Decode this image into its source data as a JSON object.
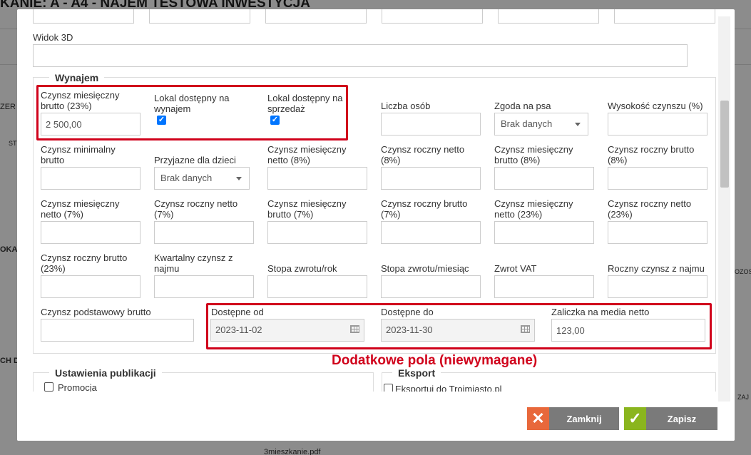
{
  "background": {
    "title": "KANIE: A - A4 - NAJEM TESTOWA INWESTYCJA",
    "fragments": [
      "ZER",
      "ST",
      "OKA",
      "CH D",
      "OZOS",
      "ZAJ",
      "3mieszkanie.pdf"
    ]
  },
  "modal": {
    "widok3d": {
      "label": "Widok 3D",
      "value": ""
    },
    "wynajem": {
      "legend": "Wynajem",
      "czynsz_miesieczny_brutto_23": {
        "label": "Czynsz miesięczny brutto (23%)",
        "value": "2 500,00"
      },
      "lokal_dostepny_na_wynajem": {
        "label": "Lokal dostępny na wynajem",
        "checked": true
      },
      "lokal_dostepny_na_sprzedaz": {
        "label": "Lokal dostępny na sprzedaż",
        "checked": true
      },
      "liczba_osob": {
        "label": "Liczba osób",
        "value": ""
      },
      "zgoda_na_psa": {
        "label": "Zgoda na psa",
        "value": "Brak danych"
      },
      "wysokosc_czynszu": {
        "label": "Wysokość czynszu (%)",
        "value": ""
      },
      "czynsz_minimalny_brutto": {
        "label": "Czynsz minimalny brutto",
        "value": ""
      },
      "przyjazne_dla_dzieci": {
        "label": "Przyjazne dla dzieci",
        "value": "Brak danych"
      },
      "czynsz_miesieczny_netto_8": {
        "label": "Czynsz miesięczny netto (8%)",
        "value": ""
      },
      "czynsz_roczny_netto_8": {
        "label": "Czynsz roczny netto (8%)",
        "value": ""
      },
      "czynsz_miesieczny_brutto_8": {
        "label": "Czynsz miesięczny brutto (8%)",
        "value": ""
      },
      "czynsz_roczny_brutto_8": {
        "label": "Czynsz roczny brutto (8%)",
        "value": ""
      },
      "czynsz_miesieczny_netto_7": {
        "label": "Czynsz miesięczny netto (7%)",
        "value": ""
      },
      "czynsz_roczny_netto_7": {
        "label": "Czynsz roczny netto (7%)",
        "value": ""
      },
      "czynsz_miesieczny_brutto_7": {
        "label": "Czynsz miesięczny brutto (7%)",
        "value": ""
      },
      "czynsz_roczny_brutto_7": {
        "label": "Czynsz roczny brutto (7%)",
        "value": ""
      },
      "czynsz_miesieczny_netto_23": {
        "label": "Czynsz miesięczny netto (23%)",
        "value": ""
      },
      "czynsz_roczny_netto_23": {
        "label": "Czynsz roczny netto (23%)",
        "value": ""
      },
      "czynsz_roczny_brutto_23": {
        "label": "Czynsz roczny brutto (23%)",
        "value": ""
      },
      "kwartalny_czynsz": {
        "label": "Kwartalny czynsz z najmu",
        "value": ""
      },
      "stopa_zwrotu_rok": {
        "label": "Stopa zwrotu/rok",
        "value": ""
      },
      "stopa_zwrotu_miesiac": {
        "label": "Stopa zwrotu/miesiąc",
        "value": ""
      },
      "zwrot_vat": {
        "label": "Zwrot VAT",
        "value": ""
      },
      "roczny_czynsz": {
        "label": "Roczny czynsz z najmu",
        "value": ""
      },
      "czynsz_podstawowy_brutto": {
        "label": "Czynsz podstawowy brutto",
        "value": ""
      },
      "dostepne_od": {
        "label": "Dostępne od",
        "value": "2023-11-02"
      },
      "dostepne_do": {
        "label": "Dostępne do",
        "value": "2023-11-30"
      },
      "zaliczka": {
        "label": "Zaliczka na media netto",
        "value": "123,00"
      }
    },
    "annotation": "Dodatkowe pola (niewymagane)",
    "publikacja": {
      "legend": "Ustawienia publikacji",
      "promocja": {
        "label": "Promocja",
        "checked": false
      }
    },
    "eksport": {
      "legend": "Eksport",
      "trojmiasto": {
        "label": "Eksportuj do Trojmiasto.pl",
        "checked": false
      }
    },
    "buttons": {
      "close": "Zamknij",
      "save": "Zapisz"
    },
    "colors": {
      "close_icon_bg": "#e8683b",
      "save_icon_bg": "#8ab51e",
      "button_text_bg": "#7a7a7a",
      "annotation_red": "#d0021b",
      "checkbox_blue": "#0075ff"
    }
  }
}
